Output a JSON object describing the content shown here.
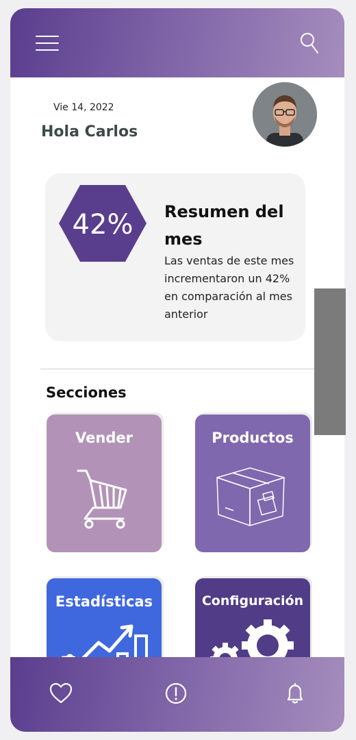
{
  "header": {
    "menu_icon": "hamburger-menu-icon",
    "search_icon": "search-icon"
  },
  "greeting": {
    "date": "Vie 14, 2022",
    "title": "Hola Carlos"
  },
  "summary": {
    "percent": "42%",
    "title": "Resumen del mes",
    "text": "Las ventas de este mes incrementaron un 42% en comparación al mes anterior"
  },
  "sections": {
    "title": "Secciones",
    "items": [
      {
        "label": "Vender",
        "icon": "shopping-cart-icon",
        "color": "#b293b7"
      },
      {
        "label": "Productos",
        "icon": "box-icon",
        "color": "#8068ae"
      },
      {
        "label": "Estadísticas",
        "icon": "chart-icon",
        "color": "#3f68de"
      },
      {
        "label": "Configuración",
        "icon": "gears-icon",
        "color": "#513c88"
      }
    ]
  },
  "bottom_nav": {
    "items": [
      {
        "icon": "heart-icon"
      },
      {
        "icon": "alert-icon"
      },
      {
        "icon": "bell-icon"
      }
    ]
  },
  "colors": {
    "accent": "#5a3e8e",
    "accent_light": "#a58dbd",
    "hexagon": "#5a3e8e"
  }
}
